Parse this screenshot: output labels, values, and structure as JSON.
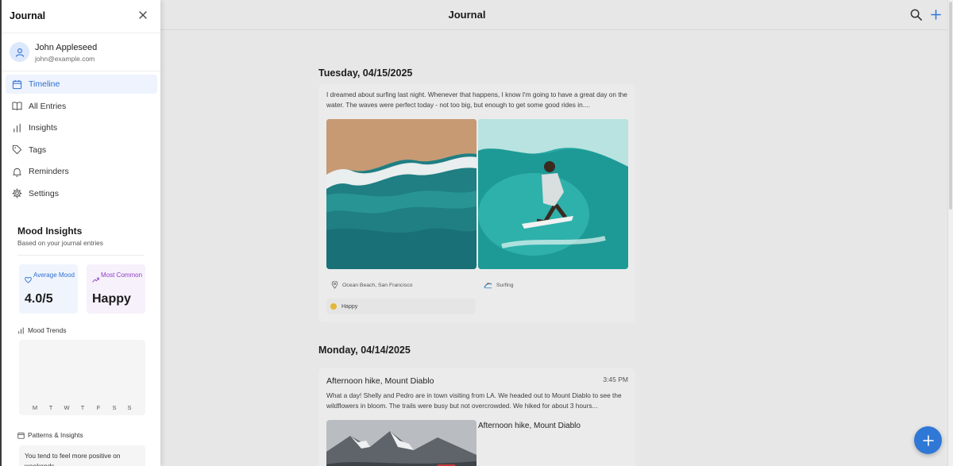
{
  "app": {
    "title": "Journal"
  },
  "icons": {
    "search": "search-icon",
    "add": "plus-icon",
    "close": "close-icon",
    "fab": "plus-icon"
  },
  "colors": {
    "accent": "#2f78d6",
    "sidebar_active": "#2f6fd0",
    "mood_dot": "#e4b634"
  },
  "entries": [
    {
      "date": "Tuesday, 04/15/2025",
      "text": "I dreamed about surfing last night. Whenever that happens, I know I'm going to have a great day on the water. The waves were perfect today - not too big, but enough to get some good rides in....",
      "location": "Ocean Beach, San Francisco",
      "activity": "Surfing",
      "mood": "Happy"
    },
    {
      "date": "Monday, 04/14/2025",
      "title": "Afternoon hike, Mount Diablo",
      "time": "3:45 PM",
      "text": "What a day! Shelly and Pedro are in town visiting from LA. We headed out to Mount Diablo to see the wildflowers in bloom. The trails were busy but not overcrowded. We hiked for about 3 hours...",
      "photo_caption": "Afternoon hike, Mount Diablo"
    }
  ],
  "sidebar": {
    "title": "Journal",
    "user": {
      "name": "John Appleseed",
      "email": "john@example.com"
    },
    "nav": [
      {
        "label": "Timeline",
        "icon": "calendar-icon",
        "active": true
      },
      {
        "label": "All Entries",
        "icon": "book-icon"
      },
      {
        "label": "Insights",
        "icon": "bar-chart-icon"
      },
      {
        "label": "Tags",
        "icon": "tag-icon"
      },
      {
        "label": "Reminders",
        "icon": "bell-icon"
      },
      {
        "label": "Settings",
        "icon": "gear-icon"
      }
    ],
    "mood_insights": {
      "title": "Mood Insights",
      "subtitle": "Based on your journal entries",
      "average_label": "Average Mood",
      "average_value": "4.0/5",
      "common_label": "Most Common",
      "common_value": "Happy",
      "trends_label": "Mood Trends",
      "days": [
        "M",
        "T",
        "W",
        "T",
        "F",
        "S",
        "S"
      ],
      "patterns_label": "Patterns & Insights",
      "pattern_text": "You tend to feel more positive on weekends."
    }
  }
}
